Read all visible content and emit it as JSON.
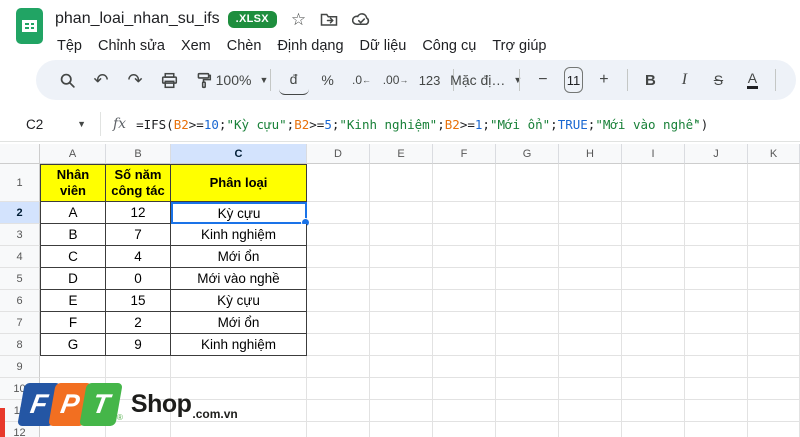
{
  "titlebar": {
    "doc_title": "phan_loai_nhan_su_ifs",
    "badge": ".XLSX",
    "star_icon": "☆"
  },
  "menu": {
    "items": [
      "Tệp",
      "Chỉnh sửa",
      "Xem",
      "Chèn",
      "Định dạng",
      "Dữ liệu",
      "Công cụ",
      "Trợ giúp"
    ]
  },
  "toolbar": {
    "zoom_value": "100%",
    "currency_label": "đ",
    "percent_label": "%",
    "decrease_decimal": ".0",
    "increase_decimal": ".00",
    "more_formats": "123",
    "font_name": "Mặc đị…",
    "minus_label": "−",
    "font_size": "11",
    "plus_label": "+",
    "bold_label": "B",
    "italic_label": "I",
    "strikethrough_label": "S",
    "text_color_label": "A"
  },
  "formula_bar": {
    "cell_ref": "C2",
    "fx_label": "fx",
    "tokens": [
      {
        "text": "=IFS(",
        "kind": "p"
      },
      {
        "text": "B2",
        "kind": "r"
      },
      {
        "text": ">=",
        "kind": "p"
      },
      {
        "text": "10",
        "kind": "n"
      },
      {
        "text": ";",
        "kind": "p"
      },
      {
        "text": "\"Kỳ cựu\"",
        "kind": "s"
      },
      {
        "text": ";",
        "kind": "p"
      },
      {
        "text": "B2",
        "kind": "r"
      },
      {
        "text": ">=",
        "kind": "p"
      },
      {
        "text": "5",
        "kind": "n"
      },
      {
        "text": ";",
        "kind": "p"
      },
      {
        "text": "\"Kinh nghiệm\"",
        "kind": "s"
      },
      {
        "text": ";",
        "kind": "p"
      },
      {
        "text": "B2",
        "kind": "r"
      },
      {
        "text": ">=",
        "kind": "p"
      },
      {
        "text": "1",
        "kind": "n"
      },
      {
        "text": ";",
        "kind": "p"
      },
      {
        "text": "\"Mới ổn\"",
        "kind": "s"
      },
      {
        "text": ";",
        "kind": "p"
      },
      {
        "text": "TRUE",
        "kind": "n"
      },
      {
        "text": ";",
        "kind": "p"
      },
      {
        "text": "\"Mới vào nghề\"",
        "kind": "s"
      },
      {
        "text": ")",
        "kind": "p"
      }
    ]
  },
  "grid": {
    "columns": [
      {
        "label": "A",
        "width": 66
      },
      {
        "label": "B",
        "width": 65
      },
      {
        "label": "C",
        "width": 136
      },
      {
        "label": "D",
        "width": 63
      },
      {
        "label": "E",
        "width": 63
      },
      {
        "label": "F",
        "width": 63
      },
      {
        "label": "G",
        "width": 63
      },
      {
        "label": "H",
        "width": 63
      },
      {
        "label": "I",
        "width": 63
      },
      {
        "label": "J",
        "width": 63
      },
      {
        "label": "K",
        "width": 52
      }
    ],
    "row_header_width": 40,
    "selected_cell": {
      "column": "C",
      "row": 2
    },
    "rows": [
      {
        "n": 1,
        "height": 38,
        "is_header": true,
        "cells": [
          "Nhân viên",
          "Số năm công tác",
          "Phân loại"
        ]
      },
      {
        "n": 2,
        "height": 22,
        "cells": [
          "A",
          "12",
          "Kỳ cựu"
        ]
      },
      {
        "n": 3,
        "height": 22,
        "cells": [
          "B",
          "7",
          "Kinh nghiệm"
        ]
      },
      {
        "n": 4,
        "height": 22,
        "cells": [
          "C",
          "4",
          "Mới ổn"
        ]
      },
      {
        "n": 5,
        "height": 22,
        "cells": [
          "D",
          "0",
          "Mới vào nghề"
        ]
      },
      {
        "n": 6,
        "height": 22,
        "cells": [
          "E",
          "15",
          "Kỳ cựu"
        ]
      },
      {
        "n": 7,
        "height": 22,
        "cells": [
          "F",
          "2",
          "Mới ổn"
        ]
      },
      {
        "n": 8,
        "height": 22,
        "cells": [
          "G",
          "9",
          "Kinh nghiệm"
        ]
      },
      {
        "n": 9,
        "height": 22,
        "cells": []
      },
      {
        "n": 10,
        "height": 22,
        "cells": []
      },
      {
        "n": 11,
        "height": 22,
        "cells": []
      },
      {
        "n": 12,
        "height": 22,
        "cells": []
      }
    ]
  },
  "watermark": {
    "letters": [
      {
        "char": "F",
        "color": "#2456a4"
      },
      {
        "char": "P",
        "color": "#f26f21"
      },
      {
        "char": "T",
        "color": "#45b649"
      }
    ],
    "registered": "®",
    "shop": "Shop",
    "domain": ".com.vn"
  },
  "colors": {
    "accent_blue": "#1a73e8",
    "selected_header_bg": "#d3e3fd",
    "table_header_bg": "#ffff00",
    "badge_green": "#1e8e3e",
    "token_plain": "#202124",
    "token_ref": "#e8710a",
    "token_num": "#1967d2",
    "token_str": "#188038"
  }
}
